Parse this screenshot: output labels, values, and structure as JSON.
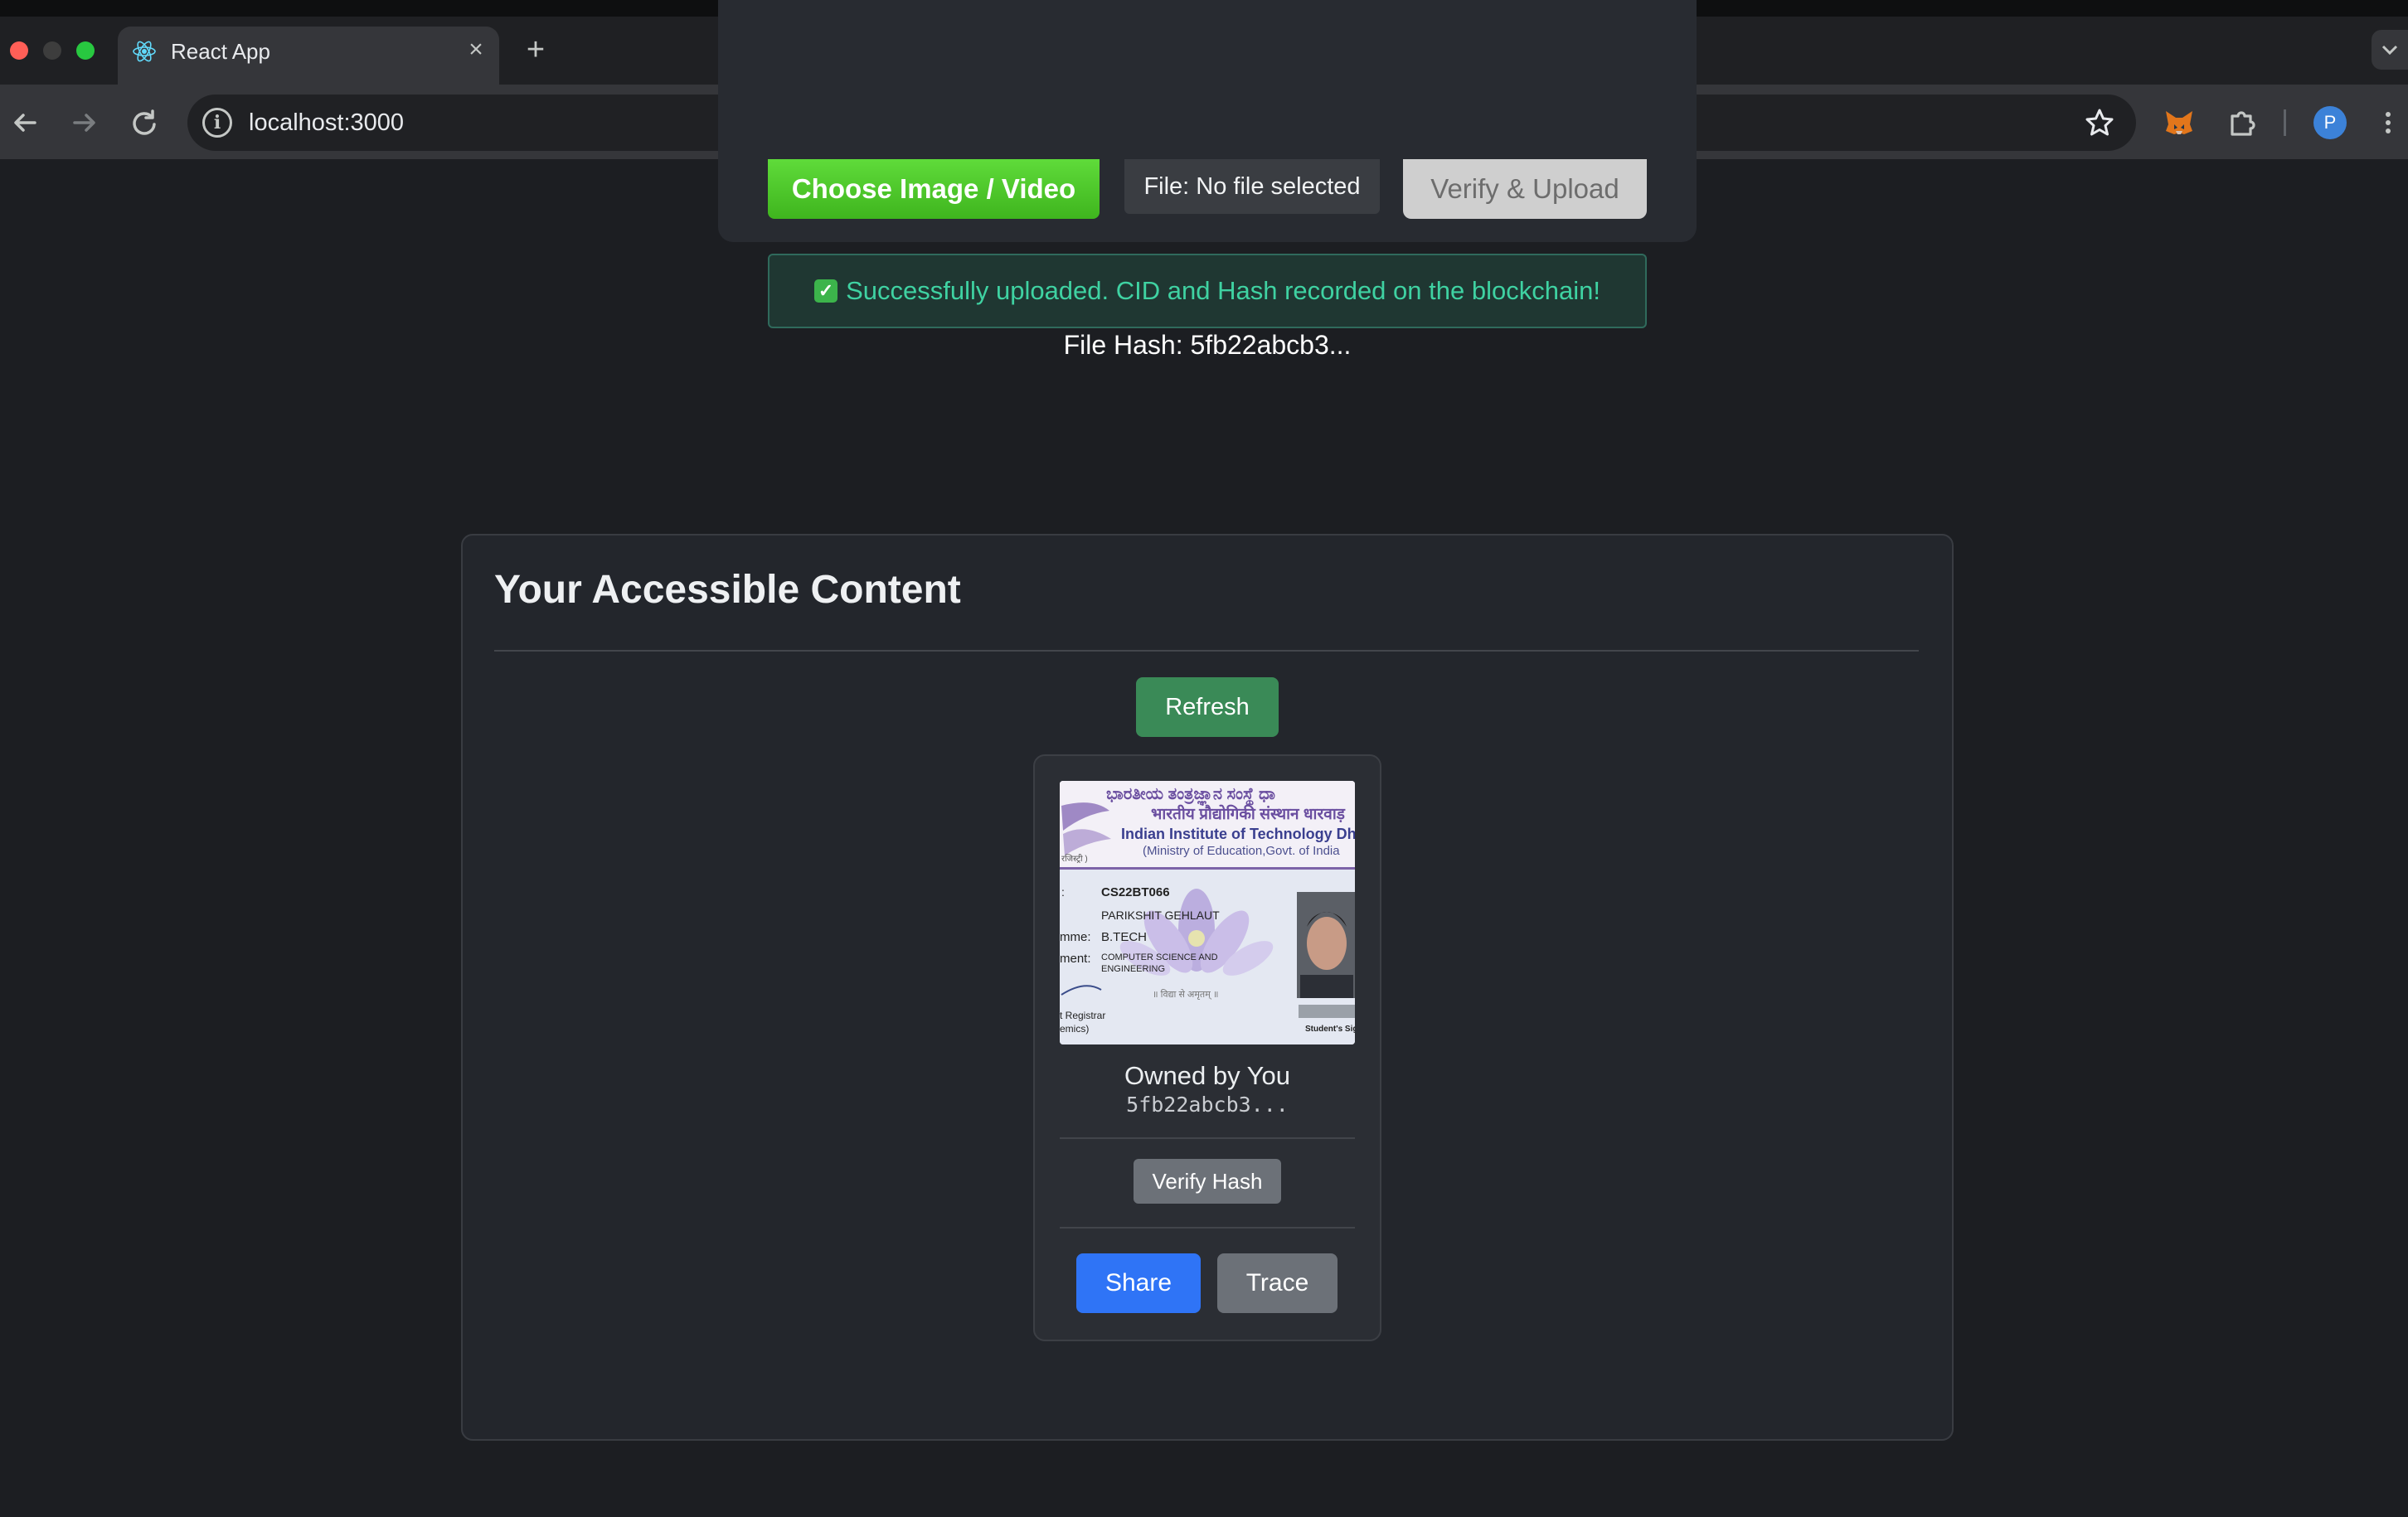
{
  "browser": {
    "tab_title": "React App",
    "tab_close": "×",
    "new_tab": "+",
    "url": "localhost:3000",
    "profile_initial": "P",
    "icons": [
      "react-favicon-icon",
      "back-arrow-icon",
      "forward-arrow-icon",
      "reload-icon",
      "site-info-icon",
      "bookmark-star-icon",
      "metamask-fox-icon",
      "extensions-puzzle-icon",
      "profile-avatar-icon",
      "menu-kebab-icon",
      "tab-search-chevron-icon"
    ],
    "colors": {
      "traffic_red": "#ff5f57",
      "traffic_yellow": "#3d3d3d",
      "traffic_green": "#28c840"
    }
  },
  "upload": {
    "choose_label": "Choose Image / Video",
    "file_label": "File: No file selected",
    "verify_upload_label": "Verify & Upload",
    "success_icon": "✓",
    "success_message": "Successfully uploaded. CID and Hash recorded on the blockchain!",
    "file_hash": "File Hash: 5fb22abcb3..."
  },
  "content": {
    "title": "Your Accessible Content",
    "refresh_label": "Refresh",
    "items": [
      {
        "image": {
          "header_regional": "ಭಾರತೀಯ ತಂತ್ರಜ್ಞಾನ ಸಂಸ್ಥೆ ಧಾ",
          "header_hindi": "भारतीय प्रौद्योगिकी संस्थान धारवाड़",
          "institute": "Indian Institute of Technology Dha",
          "ministry": "(Ministry of Education,Govt. of India",
          "small_left": "रजिस्ट्री )",
          "roll_label": ":",
          "roll": "CS22BT066",
          "name": "PARIKSHIT GEHLAUT",
          "programme_label": "mme:",
          "programme": "B.TECH",
          "department_label": "ment:",
          "department_1": "COMPUTER SCIENCE AND",
          "department_2": "ENGINEERING",
          "motto": "॥ विद्या से अमृतम् ॥",
          "registrar_1": "t Registrar",
          "registrar_2": "emics)",
          "signature": "Student's Sig"
        },
        "owner": "Owned by You",
        "hash": "5fb22abcb3...",
        "verify_label": "Verify Hash",
        "share_label": "Share",
        "trace_label": "Trace"
      }
    ]
  }
}
